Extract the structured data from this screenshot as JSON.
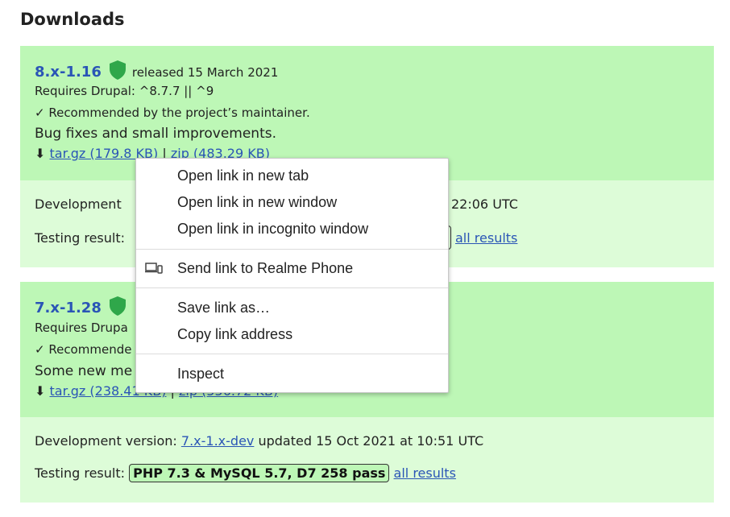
{
  "heading": "Downloads",
  "colors": {
    "release_bg": "#bdf7b6",
    "dev_bg": "#ddfcd8",
    "link": "#2a55b6",
    "shield": "#2fa74a"
  },
  "releases": [
    {
      "version": "8.x-1.16",
      "released": "released 15 March 2021",
      "requires": "Requires Drupal: ^8.7.7 || ^9",
      "recommended": "✓ Recommended by the project’s maintainer.",
      "notes": "Bug fixes and small improvements.",
      "download_icon": "⬇",
      "targz": "tar.gz (179.8 KB)",
      "separator": "|",
      "zip": "zip (483.29 KB)",
      "dev": {
        "label": "Development",
        "updated_tail": "22:06 UTC"
      },
      "testing": {
        "label": "Testing result:",
        "all_results": "all results"
      }
    },
    {
      "version": "7.x-1.28",
      "requires": "Requires Drupa",
      "recommended": "✓ Recommende",
      "notes": "Some new me",
      "download_icon": "⬇",
      "targz": "tar.gz (238.41 KB)",
      "separator": "|",
      "zip": "zip (556.72 KB)",
      "dev": {
        "label": "Development version:",
        "link": "7.x-1.x-dev",
        "updated": "updated 15 Oct 2021 at 10:51 UTC"
      },
      "testing": {
        "label": "Testing result:",
        "result": "PHP 7.3 & MySQL 5.7, D7 258 pass",
        "all_results": "all results"
      }
    }
  ],
  "context_menu": {
    "items": [
      "Open link in new tab",
      "Open link in new window",
      "Open link in incognito window",
      "Send link to Realme Phone",
      "Save link as…",
      "Copy link address",
      "Inspect"
    ],
    "send_icon": "device-icon"
  }
}
